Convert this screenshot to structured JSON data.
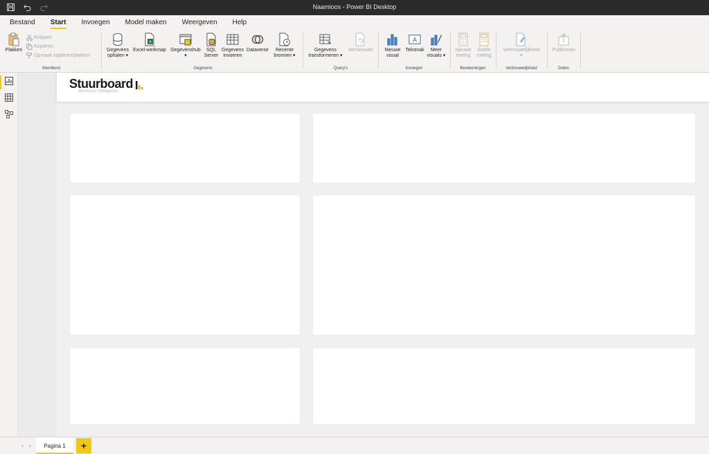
{
  "window": {
    "title": "Naamloos - Power BI Desktop"
  },
  "tabs": [
    {
      "label": "Bestand"
    },
    {
      "label": "Start"
    },
    {
      "label": "Invoegen"
    },
    {
      "label": "Model maken"
    },
    {
      "label": "Weergeven"
    },
    {
      "label": "Help"
    }
  ],
  "ribbon": {
    "klembord": {
      "label": "Klembord",
      "plakken": "Plakken",
      "knippen": "Knippen",
      "kopieren": "Kopiëren",
      "format": "Opmaak kopiëren/plakken"
    },
    "gegevens": {
      "label": "Gegevens",
      "ophalen": [
        "Gegevens",
        "ophalen ▾"
      ],
      "excel": [
        "Excel-werkmap",
        ""
      ],
      "hub": [
        "Gegevenshub",
        "▾"
      ],
      "sql": [
        "SQL",
        "Server"
      ],
      "invoeren": [
        "Gegevens",
        "invoeren"
      ],
      "dataverse": [
        "Dataverse",
        ""
      ],
      "recente": [
        "Recente",
        "bronnen ▾"
      ]
    },
    "querys": {
      "label": "Query's",
      "transformeren": [
        "Gegevens",
        "transformeren ▾"
      ],
      "vernieuwen": [
        "Vernieuwen",
        ""
      ]
    },
    "invoegen": {
      "label": "Invoegen",
      "visual": [
        "Nieuwe",
        "visual"
      ],
      "tekstvak": [
        "Tekstvak",
        ""
      ],
      "meer": [
        "Meer",
        "visuals ▾"
      ]
    },
    "berekeningen": {
      "label": "Berekeningen",
      "meting": [
        "Nieuwe",
        "meting"
      ],
      "snel": [
        "Snelle",
        "meting"
      ]
    },
    "vertrouwelijkheid": {
      "label": "Vertrouwelijkheid",
      "btn": [
        "Vertrouwelijkheid",
        "▾"
      ]
    },
    "delen": {
      "label": "Delen",
      "publiceren": [
        "Publiceren",
        ""
      ]
    }
  },
  "logo": {
    "word": "Stuurboard",
    "tag": "Business Intelligence"
  },
  "pages": {
    "current": "Pagina 1",
    "add": "+",
    "prev": "‹",
    "next": "›"
  },
  "colors": {
    "accent": "#f2c811",
    "titlebar": "#2b2b2b",
    "excel": "#217346"
  }
}
